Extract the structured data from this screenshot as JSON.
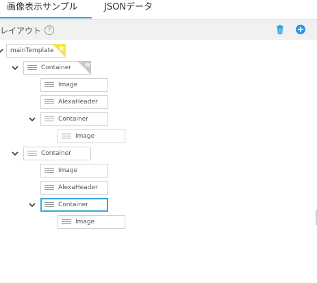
{
  "tabs": [
    {
      "label": "画像表示サンプル",
      "active": true
    },
    {
      "label": "JSONデータ",
      "active": false
    }
  ],
  "toolbar": {
    "title": "レイアウト",
    "help_glyph": "?",
    "icons": [
      "trash-icon",
      "add-circle-icon"
    ]
  },
  "colors": {
    "accent": "#3a9ee0",
    "selected_border": "#3aa8df",
    "toolbar_bg": "#f1f1f1",
    "star_badge": "#f5e84a",
    "w_badge": "#c8c8c8"
  },
  "tree": {
    "root": {
      "label": "mainTemplate",
      "badge": "star"
    },
    "nodes": [
      {
        "label": "Container",
        "depth": 1,
        "expanded": true,
        "badge": "W"
      },
      {
        "label": "Image",
        "depth": 2
      },
      {
        "label": "AlexaHeader",
        "depth": 2
      },
      {
        "label": "Container",
        "depth": 2,
        "expanded": true
      },
      {
        "label": "Image",
        "depth": 3
      },
      {
        "label": "Container",
        "depth": 1,
        "expanded": true
      },
      {
        "label": "Image",
        "depth": 2
      },
      {
        "label": "AlexaHeader",
        "depth": 2
      },
      {
        "label": "Container",
        "depth": 2,
        "expanded": true,
        "selected": true
      },
      {
        "label": "Image",
        "depth": 3
      }
    ]
  }
}
